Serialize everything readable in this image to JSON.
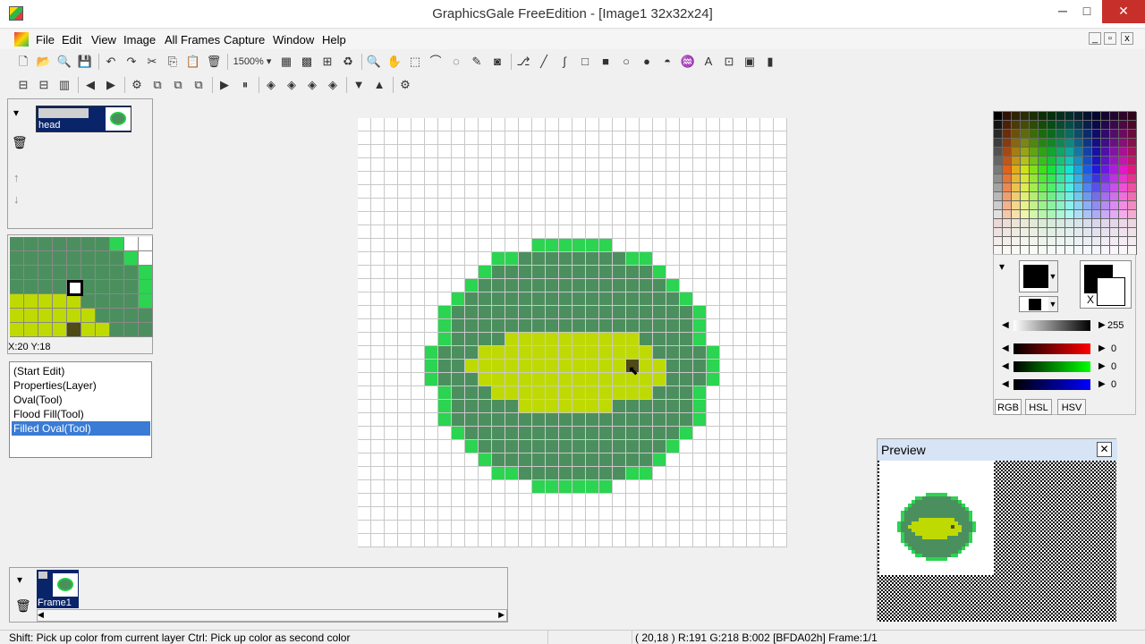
{
  "window": {
    "title": "GraphicsGale FreeEdition - [Image1 32x32x24]",
    "minimize": "─",
    "maximize": "□",
    "close": "✕"
  },
  "menu": {
    "items": [
      "File",
      "Edit",
      "View",
      "Image",
      "All Frames",
      "Capture",
      "Window",
      "Help"
    ],
    "mdi_buttons": [
      "_",
      "▫",
      "x"
    ]
  },
  "toolbar1": {
    "zoom_label": "1500%",
    "icons": [
      "new-icon",
      "open-icon",
      "zoom-icon",
      "save-icon",
      "undo-icon",
      "redo-icon",
      "cut-icon",
      "copy-icon",
      "paste-icon",
      "delete-icon",
      "grid-icon",
      "pixel-grid-icon",
      "dot-grid-icon",
      "recolor-icon",
      "magnifier-icon",
      "hand-icon",
      "rect-select-icon",
      "lasso-select-icon",
      "magic-select-icon",
      "wand-icon",
      "select-mode-icon",
      "pen-icon",
      "line-icon",
      "curve-icon",
      "rect-icon",
      "filled-rect-icon",
      "oval-icon",
      "filled-oval-icon",
      "fill-icon",
      "brush-icon",
      "text-icon",
      "mask-icon",
      "layer-mask-icon",
      "dropper-icon"
    ],
    "glyphs": [
      "🗋",
      "📂",
      "🔍",
      "💾",
      "↶",
      "↷",
      "✂",
      "⎘",
      "📋",
      "🗑",
      "▦",
      "▩",
      "⊞",
      "♻",
      "🔍",
      "✋",
      "⬚",
      "⌒",
      "◌",
      "✎",
      "◙",
      "⎇",
      "╱",
      "∫",
      "□",
      "■",
      "○",
      "●",
      "◓",
      "♒",
      "A",
      "⊡",
      "▣",
      "▮"
    ]
  },
  "toolbar2": {
    "icons": [
      "layer-menu-icon",
      "frame-menu-icon",
      "grid-options-icon",
      "prev-frame-icon",
      "next-frame-icon",
      "frame-props-icon",
      "copy-frame-icon",
      "paste-frame-icon",
      "dup-frame-icon",
      "play-icon",
      "pause-icon",
      "add-layer-icon",
      "dup-layer-icon",
      "merge-layer-icon",
      "lock-layer-icon",
      "move-down-icon",
      "move-up-icon",
      "layer-props-icon"
    ],
    "glyphs": [
      "⊟",
      "⊟",
      "▥",
      "◀",
      "▶",
      "⚙",
      "⧉",
      "⧉",
      "⧉",
      "▶",
      "⏸",
      "◈",
      "◈",
      "◈",
      "◈",
      "▼",
      "▲",
      "⚙"
    ]
  },
  "layers": {
    "name": "head",
    "icons": [
      "▾",
      "🗑",
      "↑",
      "↓"
    ]
  },
  "navigator": {
    "coords": "X:20 Y:18"
  },
  "history": {
    "items": [
      "(Start Edit)",
      "Properties(Layer)",
      "Oval(Tool)",
      "Flood Fill(Tool)",
      "Filled Oval(Tool)"
    ],
    "selected_index": 4
  },
  "image": {
    "size": 32,
    "colors": {
      "bg": "#ffffff",
      "rim": "#2bd451",
      "body": "#4c8f5e",
      "eye": "#bfda02",
      "pupil": "#4f4a16"
    }
  },
  "color_panel": {
    "fg_label": "",
    "x_label": "X",
    "gray_value": "255",
    "r_value": "0",
    "g_value": "0",
    "b_value": "0",
    "tabs": [
      "RGB",
      "HSL",
      "HSV"
    ]
  },
  "preview": {
    "title": "Preview",
    "close": "✕"
  },
  "frames": {
    "label": "Frame1"
  },
  "status": {
    "hint": "Shift: Pick up color from current layer  Ctrl: Pick up color as second color",
    "pixel_info": "( 20,18 ) R:191 G:218 B:002  [BFDA02h]  Frame:1/1"
  }
}
